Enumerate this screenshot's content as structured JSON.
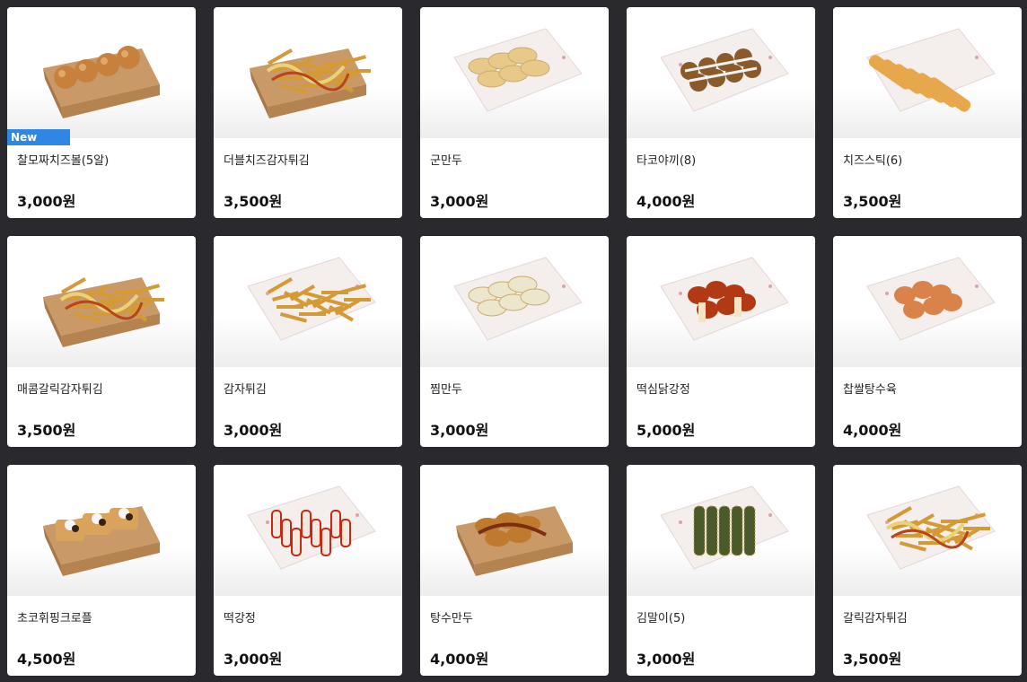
{
  "items": [
    {
      "name": "찰모짜치즈볼(5알)",
      "price": "3,000원",
      "badge": "New",
      "icon": "cheese-balls-icon",
      "food": "balls",
      "tray": "box"
    },
    {
      "name": "더블치즈감자튀김",
      "price": "3,500원",
      "icon": "cheese-fries-icon",
      "food": "fries-sauce",
      "tray": "box"
    },
    {
      "name": "군만두",
      "price": "3,000원",
      "icon": "fried-dumplings-icon",
      "food": "dumplings",
      "tray": "paper"
    },
    {
      "name": "타코야끼(8)",
      "price": "4,000원",
      "icon": "takoyaki-icon",
      "food": "takoyaki",
      "tray": "paper"
    },
    {
      "name": "치즈스틱(6)",
      "price": "3,500원",
      "icon": "cheese-sticks-icon",
      "food": "sticks",
      "tray": "paper"
    },
    {
      "name": "매콤갈릭감자튀김",
      "price": "3,500원",
      "icon": "spicy-garlic-fries-icon",
      "food": "fries-sauce",
      "tray": "box"
    },
    {
      "name": "감자튀김",
      "price": "3,000원",
      "icon": "french-fries-icon",
      "food": "fries",
      "tray": "paper"
    },
    {
      "name": "찜만두",
      "price": "3,000원",
      "icon": "steamed-dumplings-icon",
      "food": "dumplings-pale",
      "tray": "paper"
    },
    {
      "name": "떡심닭강정",
      "price": "5,000원",
      "icon": "sweet-chicken-icon",
      "food": "chicken",
      "tray": "paper"
    },
    {
      "name": "찹쌀탕수육",
      "price": "4,000원",
      "icon": "sweet-sour-pork-icon",
      "food": "pork",
      "tray": "paper"
    },
    {
      "name": "초코휘핑크로플",
      "price": "4,500원",
      "icon": "choco-croffle-icon",
      "food": "croffle",
      "tray": "box"
    },
    {
      "name": "떡강정",
      "price": "3,000원",
      "icon": "rice-cake-icon",
      "food": "ricecake",
      "tray": "paper"
    },
    {
      "name": "탕수만두",
      "price": "4,000원",
      "icon": "sweet-sour-dumplings-icon",
      "food": "sweet-dumplings",
      "tray": "box"
    },
    {
      "name": "김말이(5)",
      "price": "3,000원",
      "icon": "seaweed-rolls-icon",
      "food": "seaweed",
      "tray": "paper"
    },
    {
      "name": "갈릭감자튀김",
      "price": "3,500원",
      "icon": "garlic-fries-icon",
      "food": "fries-sauce",
      "tray": "paper"
    }
  ],
  "colors": {
    "background": "#2a2a2e",
    "badge": "#2f86e4",
    "box": "#c9a070",
    "paper": "#f6f0ee"
  }
}
